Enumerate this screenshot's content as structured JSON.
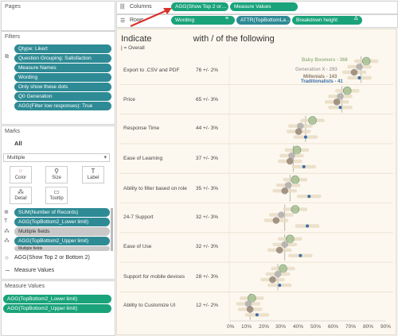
{
  "pages": {
    "title": "Pages"
  },
  "columns": {
    "label": "Columns",
    "pills": [
      "AGG(Show Top 2 or…",
      "Measure Values"
    ]
  },
  "rows": {
    "label": "Rows",
    "pills": [
      "Wording",
      "ATTR(TopBottomLa…",
      "Breakdown height"
    ]
  },
  "filters": {
    "title": "Filters",
    "items": [
      "Qtype: Likert",
      "Question Grouping: Satisfaction",
      "Measure Names",
      "Wording",
      "Only show these dots",
      "Q0 Generation",
      "AGG(Filter low responses): True"
    ]
  },
  "marks": {
    "title": "Marks",
    "all_label": "All",
    "type": "Multiple",
    "buttons": [
      "Color",
      "Size",
      "Label",
      "Detail",
      "Tooltip"
    ],
    "fields": [
      "SUM(Number of Records)",
      "AGG(TopBottom2_Lower limit)",
      "Multiple fields",
      "AGG(TopBottom2_Upper limit)",
      "Multiple fields"
    ],
    "sub_items": [
      "AGG(Show Top 2 or Bottom 2)",
      "Measure Values"
    ]
  },
  "measure_values": {
    "title": "Measure Values",
    "items": [
      "AGG(TopBottom2_Lower limit)",
      "AGG(TopBottom2_Upper limit)"
    ]
  },
  "viz": {
    "title_part1": "Indicate",
    "title_part2": "with / of the following",
    "subtitle": "| = Overall",
    "legend": [
      {
        "label": "Baby Boomers - 368",
        "color": "#9cb98a"
      },
      {
        "label": "Generation X - 293",
        "color": "#a8a8a8"
      },
      {
        "label": "Millenials - 143",
        "color": "#8a7a6a"
      },
      {
        "label": "Traditionalists - 41",
        "color": "#3b6ea8"
      }
    ],
    "x_ticks": [
      "0%",
      "10%",
      "20%",
      "30%",
      "40%",
      "50%",
      "60%",
      "70%",
      "80%",
      "90%"
    ]
  },
  "chart_data": {
    "type": "scatter",
    "categories": [
      "Export to .CSV and PDF",
      "Price",
      "Response Time",
      "Ease of Learning",
      "Ability to filter based on role",
      "24-7 Support",
      "Ease of Use",
      "Support for mobile devices",
      "Ability to Customize UI"
    ],
    "overall_labels": [
      "76 +/- 2%",
      "65 +/- 3%",
      "44 +/- 3%",
      "37 +/- 3%",
      "35 +/- 3%",
      "32 +/- 3%",
      "32 +/- 3%",
      "28 +/- 3%",
      "12 +/- 2%"
    ],
    "overall": [
      76,
      65,
      44,
      37,
      35,
      32,
      32,
      28,
      12
    ],
    "series": [
      {
        "name": "Baby Boomers - 368",
        "values": [
          79,
          68,
          48,
          39,
          38,
          38,
          35,
          31,
          13
        ]
      },
      {
        "name": "Generation X - 293",
        "values": [
          75,
          64,
          41,
          36,
          34,
          30,
          32,
          28,
          11
        ]
      },
      {
        "name": "Millenials - 143",
        "values": [
          72,
          62,
          40,
          35,
          32,
          27,
          29,
          25,
          12
        ]
      },
      {
        "name": "Traditionalists - 41",
        "values": [
          75,
          64,
          44,
          43,
          46,
          45,
          41,
          29,
          16
        ]
      }
    ],
    "xlim": [
      0,
      90
    ]
  }
}
